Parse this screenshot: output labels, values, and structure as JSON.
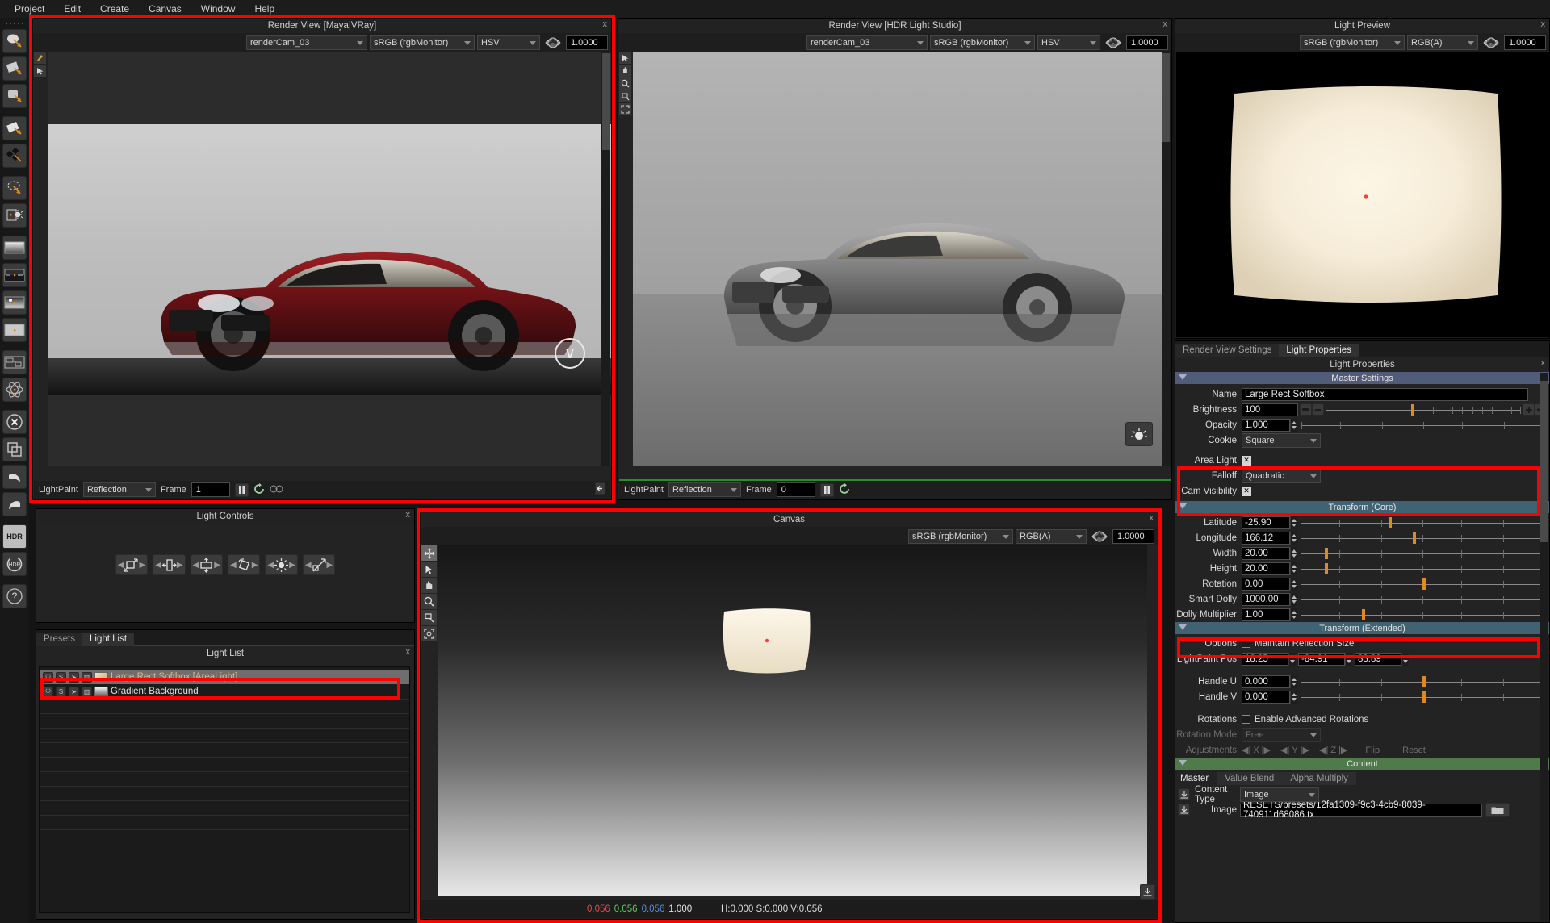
{
  "menubar": {
    "items": [
      "Project",
      "Edit",
      "Create",
      "Canvas",
      "Window",
      "Help"
    ]
  },
  "left_toolbar": {
    "items": [
      {
        "name": "soft-area-light-icon",
        "title": "Area Light"
      },
      {
        "name": "rect-light-icon",
        "title": "Rect Light"
      },
      {
        "name": "soft-blob-light-icon",
        "title": "Soft Light"
      },
      {
        "name": "flat-card-light-icon",
        "title": "Card Light"
      },
      {
        "name": "multi-shape-light-icon",
        "title": "Multi Light"
      },
      {
        "name": "disc-light-icon",
        "title": "Disc Light"
      },
      {
        "name": "window-light-icon",
        "title": "Window Light"
      },
      {
        "name": "gradient-icon",
        "title": "Gradient"
      },
      {
        "name": "hdri-image-icon",
        "title": "HDRI Image"
      },
      {
        "name": "procedural-sky-icon",
        "title": "Sky"
      },
      {
        "name": "solid-color-icon",
        "title": "Solid Colour"
      },
      {
        "name": "layer-stack-icon",
        "title": "Layers"
      },
      {
        "name": "physical-icon",
        "title": "Physical"
      },
      {
        "name": "delete-icon",
        "title": "Delete"
      },
      {
        "name": "duplicate-icon",
        "title": "Duplicate"
      },
      {
        "name": "undo-icon",
        "title": "Undo"
      },
      {
        "name": "redo-icon",
        "title": "Redo"
      },
      {
        "name": "hdr-export-icon",
        "title": "HDR"
      },
      {
        "name": "hdr-refresh-icon",
        "title": "HDR Refresh"
      },
      {
        "name": "help-icon",
        "title": "Help"
      }
    ]
  },
  "render_view_maya": {
    "title": "Render View [Maya|VRay]",
    "close_label": "x",
    "camera": "renderCam_03",
    "colorspace": "sRGB (rgbMonitor)",
    "channel": "HSV",
    "exposure": "1.0000",
    "lightpaint_label": "LightPaint",
    "lightpaint_mode": "Reflection",
    "frame_label": "Frame",
    "frame_value": "1"
  },
  "render_view_hdrls": {
    "title": "Render View [HDR Light Studio]",
    "close_label": "x",
    "camera": "renderCam_03",
    "colorspace": "sRGB (rgbMonitor)",
    "channel": "HSV",
    "exposure": "1.0000",
    "lightpaint_label": "LightPaint",
    "lightpaint_mode": "Reflection",
    "frame_label": "Frame",
    "frame_value": "0"
  },
  "light_preview": {
    "title": "Light Preview",
    "close_label": "x",
    "colorspace": "sRGB (rgbMonitor)",
    "channel": "RGB(A)",
    "exposure": "1.0000"
  },
  "light_controls": {
    "title": "Light Controls",
    "close_label": "x",
    "buttons": [
      {
        "name": "scale-uniform-control",
        "title": "Scale"
      },
      {
        "name": "width-control",
        "title": "Width"
      },
      {
        "name": "height-control",
        "title": "Height"
      },
      {
        "name": "rotate-control",
        "title": "Rotate"
      },
      {
        "name": "brightness-control",
        "title": "Brightness"
      },
      {
        "name": "dolly-control",
        "title": "Dolly"
      }
    ]
  },
  "light_list": {
    "tabs": [
      {
        "label": "Presets",
        "active": false
      },
      {
        "label": "Light List",
        "active": true
      }
    ],
    "title": "Light List",
    "close_label": "x",
    "rows": [
      {
        "label": "Large Rect Softbox [AreaLight]",
        "selected": true,
        "swatch": "#e8c79a"
      },
      {
        "label": "Gradient Background",
        "selected": false,
        "swatch": "#d9d9d9"
      }
    ]
  },
  "canvas": {
    "title": "Canvas",
    "close_label": "x",
    "colorspace": "sRGB (rgbMonitor)",
    "channel": "RGB(A)",
    "exposure": "1.0000",
    "tools": [
      {
        "name": "move-tool-icon",
        "active": true
      },
      {
        "name": "select-arrow-tool-icon",
        "active": false
      },
      {
        "name": "pan-hand-tool-icon",
        "active": false
      },
      {
        "name": "zoom-magnifier-tool-icon",
        "active": false
      },
      {
        "name": "zoom-region-tool-icon",
        "active": false
      },
      {
        "name": "fit-view-tool-icon",
        "active": false
      }
    ],
    "status": {
      "r": "0.056",
      "g": "0.056",
      "b": "0.056",
      "a": "1.000",
      "hsv": "H:0.000 S:0.000 V:0.056"
    }
  },
  "properties": {
    "tabs": [
      {
        "label": "Render View Settings",
        "active": false
      },
      {
        "label": "Light Properties",
        "active": true
      }
    ],
    "panel_title": "Light Properties",
    "close_label": "x",
    "master_settings": {
      "header": "Master Settings",
      "name_label": "Name",
      "name_value": "Large Rect Softbox",
      "brightness_label": "Brightness",
      "brightness_value": "100",
      "brightness_pct": 44,
      "opacity_label": "Opacity",
      "opacity_value": "1.000",
      "opacity_pct": 99,
      "cookie_label": "Cookie",
      "cookie_value": "Square"
    },
    "light_type": {
      "area_light_label": "Area Light",
      "area_light_checked": true,
      "falloff_label": "Falloff",
      "falloff_value": "Quadratic",
      "cam_visibility_label": "Cam Visibility",
      "cam_visibility_checked": true
    },
    "transform_core": {
      "header": "Transform (Core)",
      "rows": [
        {
          "label": "Latitude",
          "value": "-25.90",
          "pct": 36
        },
        {
          "label": "Longitude",
          "value": "166.12",
          "pct": 46
        },
        {
          "label": "Width",
          "value": "20.00",
          "pct": 10
        },
        {
          "label": "Height",
          "value": "20.00",
          "pct": 10
        },
        {
          "label": "Rotation",
          "value": "0.00",
          "pct": 50
        },
        {
          "label": "Smart Dolly",
          "value": "1000.00",
          "pct": 99
        },
        {
          "label": "Dolly Multiplier",
          "value": "1.00",
          "pct": 25
        }
      ]
    },
    "transform_extended": {
      "header": "Transform (Extended)",
      "options_label": "Options",
      "maintain_reflection_label": "Maintain Reflection Size",
      "maintain_reflection_checked": false,
      "lightpaint_pos_label": "LightPaint Pos",
      "lightpaint_pos": [
        "18.25",
        "-84.91",
        "83.89"
      ],
      "handles": [
        {
          "label": "Handle U",
          "value": "0.000",
          "pct": 50
        },
        {
          "label": "Handle V",
          "value": "0.000",
          "pct": 50
        }
      ],
      "rotations_label": "Rotations",
      "enable_advanced_rotations_label": "Enable Advanced Rotations",
      "enable_advanced_rotations_checked": false,
      "rotation_mode_label": "Rotation Mode",
      "rotation_mode_value": "Free",
      "adjustments_label": "Adjustments",
      "axes": [
        "X",
        "Y",
        "Z"
      ],
      "flip_label": "Flip",
      "reset_label": "Reset"
    },
    "content": {
      "header": "Content",
      "tabs": [
        {
          "label": "Master",
          "active": true
        },
        {
          "label": "Value Blend",
          "active": false
        },
        {
          "label": "Alpha Multiply",
          "active": false
        }
      ],
      "content_type_label": "Content Type",
      "content_type_value": "Image",
      "image_label": "Image",
      "image_value": "RESETS/presets/12fa1309-f9c3-4cb9-8039-740911d68086.tx"
    }
  },
  "colors": {
    "highlight_red": "#ff0000",
    "accent_orange": "#e08a1e",
    "master_header": "#515c7a",
    "transform_header": "#3f6372",
    "content_header": "#4f7a4a"
  }
}
